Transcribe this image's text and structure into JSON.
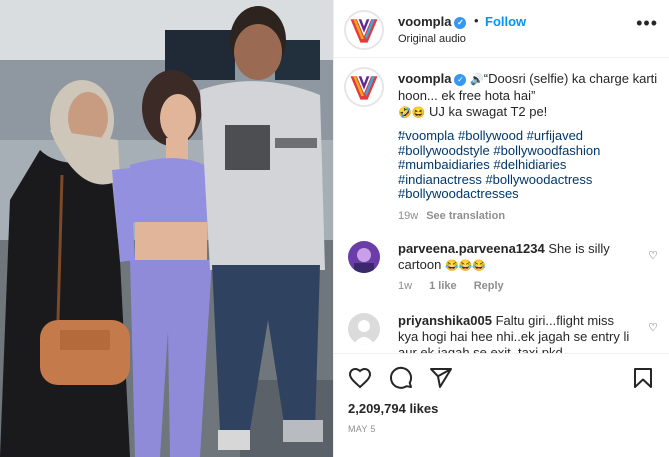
{
  "post": {
    "username": "voompla",
    "verified_badge": "✓",
    "follow_label": "Follow",
    "separator": "•",
    "audio": "Original audio",
    "more_icon": "•••",
    "caption_username": "voompla",
    "caption_text": "“Doosri (selfie) ka charge karti hoon... ek free hota hai”",
    "caption_line2": "UJ ka swagat T2 pe!",
    "caption_emojis": "🤣😆",
    "sound_emoji": "🔊",
    "dot_line": ".",
    "hashtags": [
      "#voompla",
      "#bollywood",
      "#urfijaved",
      "#bollywoodstyle",
      "#bollywoodfashion",
      "#mumbaidiaries",
      "#delhidiaries",
      "#indianactress",
      "#bollywoodactress",
      "#bollywoodactresses"
    ],
    "age": "19w",
    "see_translation": "See translation"
  },
  "comments": [
    {
      "username": "parveena.parveena1234",
      "text": "She is silly cartoon",
      "emojis": "😂😂😂",
      "age": "1w",
      "likes": "1 like",
      "reply": "Reply"
    },
    {
      "username": "priyanshika005",
      "text": "Faltu giri...flight miss kya hogi hai hee nhi..ek jagah se entry li aur ek jagah se exit..taxi pkd"
    }
  ],
  "actions": {
    "like_icon": "heart-icon",
    "comment_icon": "comment-icon",
    "share_icon": "share-icon",
    "save_icon": "bookmark-icon"
  },
  "likes_count": "2,209,794 likes",
  "date": "MAY 5",
  "colors": {
    "accent": "#0095f6",
    "link": "#00376b",
    "muted": "#8e8e8e",
    "verified": "#3897f0"
  }
}
